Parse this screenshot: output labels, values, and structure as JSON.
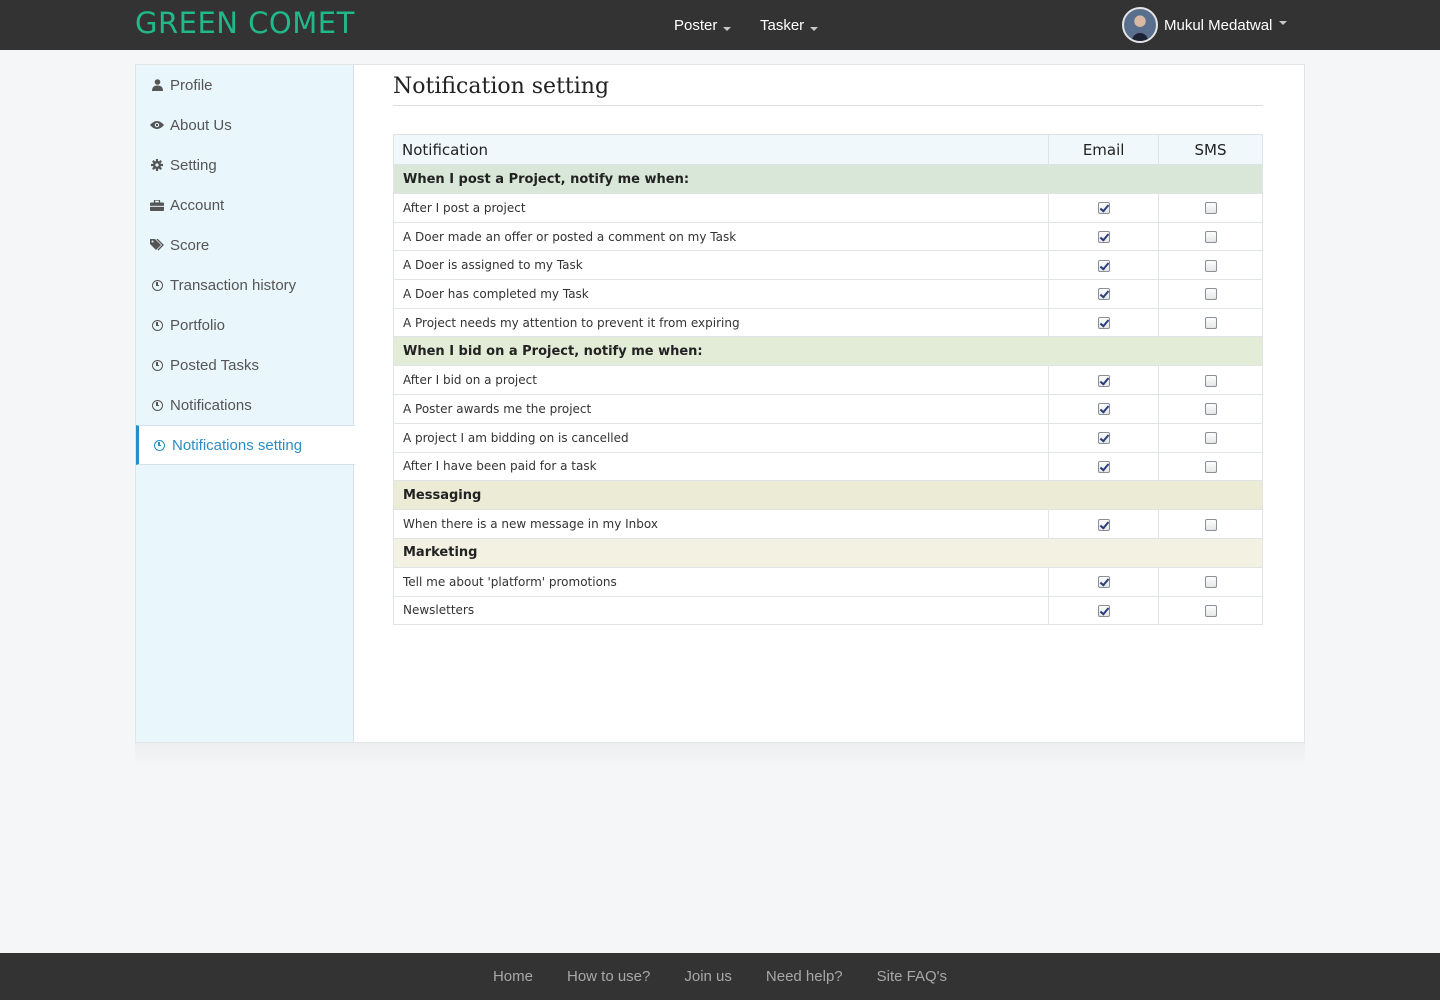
{
  "header": {
    "brand": "GREEN COMET",
    "menus": [
      {
        "label": "Poster"
      },
      {
        "label": "Tasker"
      }
    ],
    "user_name": "Mukul Medatwal"
  },
  "sidebar": {
    "items": [
      {
        "label": "Profile",
        "icon": "user-icon"
      },
      {
        "label": "About Us",
        "icon": "eye-icon"
      },
      {
        "label": "Setting",
        "icon": "gear-icon"
      },
      {
        "label": "Account",
        "icon": "briefcase-icon"
      },
      {
        "label": "Score",
        "icon": "tags-icon"
      },
      {
        "label": "Transaction history",
        "icon": "clock-icon"
      },
      {
        "label": "Portfolio",
        "icon": "clock-icon"
      },
      {
        "label": "Posted Tasks",
        "icon": "clock-icon"
      },
      {
        "label": "Notifications",
        "icon": "clock-icon"
      },
      {
        "label": "Notifications setting",
        "icon": "clock-icon",
        "active": true
      }
    ]
  },
  "main": {
    "title": "Notification setting",
    "table": {
      "headers": [
        "Notification",
        "Email",
        "SMS"
      ],
      "groups": [
        {
          "title": "When I post a Project, notify me when:",
          "color": "#d8e7d8",
          "rows": [
            {
              "label": "After I post a project",
              "email": true,
              "sms": false
            },
            {
              "label": "A Doer made an offer or posted a comment on my Task",
              "email": true,
              "sms": false
            },
            {
              "label": "A Doer is assigned to my Task",
              "email": true,
              "sms": false
            },
            {
              "label": "A Doer has completed my Task",
              "email": true,
              "sms": false
            },
            {
              "label": "A Project needs my attention to prevent it from expiring",
              "email": true,
              "sms": false
            }
          ]
        },
        {
          "title": "When I bid on a Project, notify me when:",
          "color": "#e3ecd7",
          "rows": [
            {
              "label": "After I bid on a project",
              "email": true,
              "sms": false
            },
            {
              "label": "A Poster awards me the project",
              "email": true,
              "sms": false
            },
            {
              "label": "A project I am bidding on is cancelled",
              "email": true,
              "sms": false
            },
            {
              "label": "After I have been paid for a task",
              "email": true,
              "sms": false
            }
          ]
        },
        {
          "title": "Messaging",
          "color": "#ebebd6",
          "rows": [
            {
              "label": "When there is a new message in my Inbox",
              "email": true,
              "sms": false
            }
          ]
        },
        {
          "title": "Marketing",
          "color": "#f3f2e2",
          "rows": [
            {
              "label": "Tell me about 'platform'  promotions",
              "email": true,
              "sms": false
            },
            {
              "label": "Newsletters",
              "email": true,
              "sms": false
            }
          ]
        }
      ]
    }
  },
  "footer": {
    "links": [
      "Home",
      "How to use?",
      "Join us",
      "Need help?",
      "Site FAQ's"
    ]
  },
  "colors": {
    "brand": "#1fb98a",
    "navbar": "#333333",
    "sidebar_bg": "#e9f6fb",
    "active_accent": "#2a8dc7"
  }
}
